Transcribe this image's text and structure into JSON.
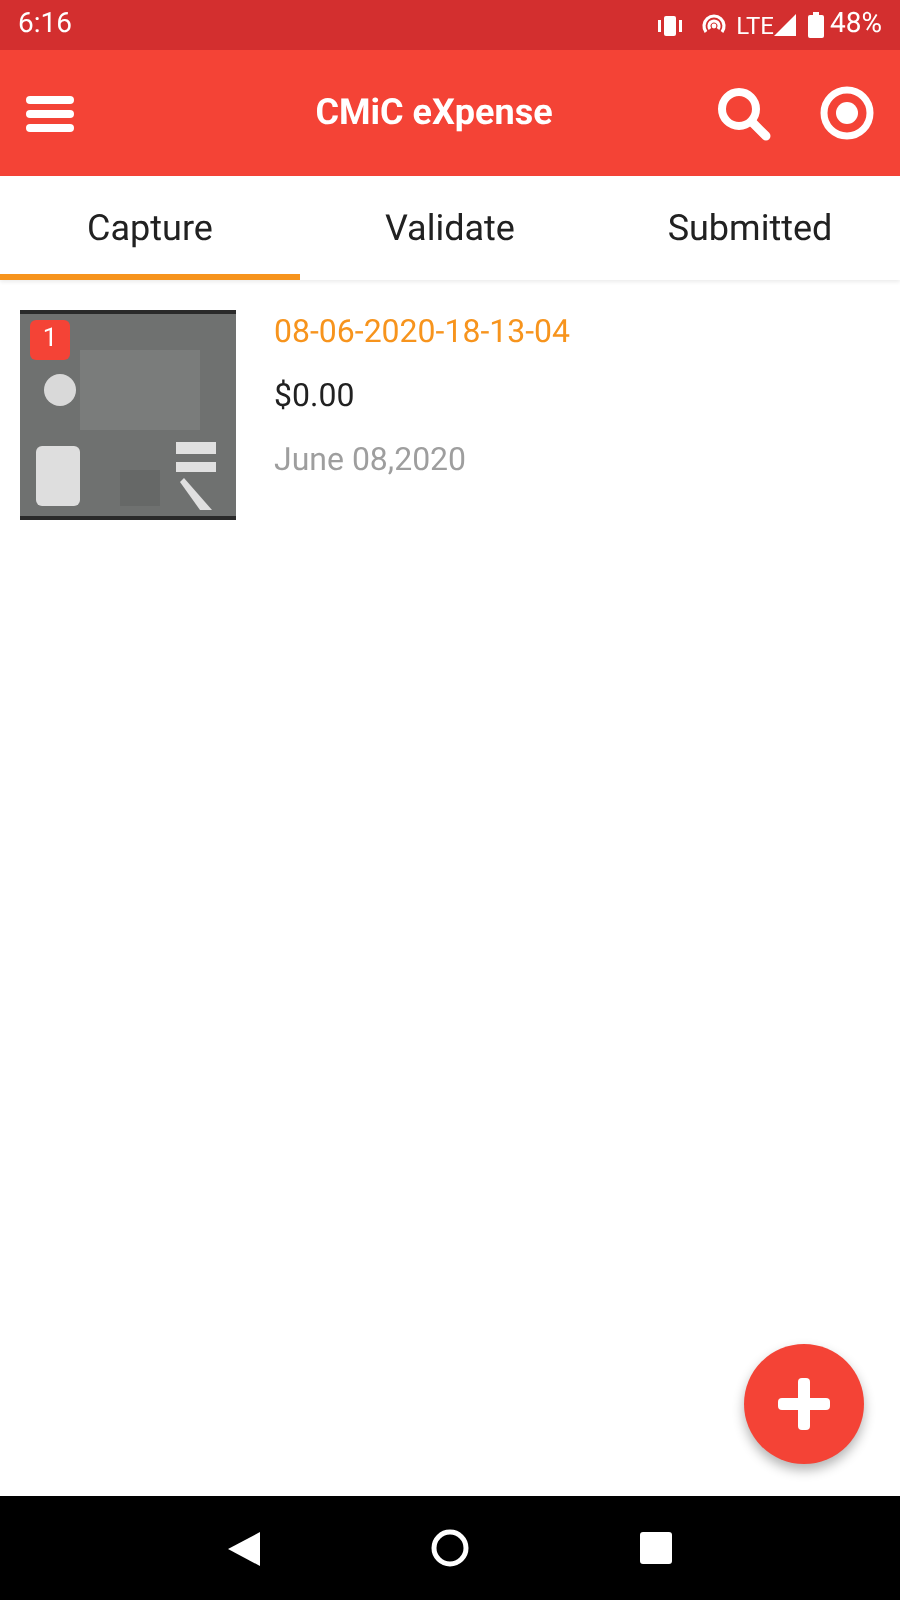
{
  "status_bar": {
    "time": "6:16",
    "network": "LTE",
    "battery": "48%"
  },
  "app_bar": {
    "title": "CMiC eXpense"
  },
  "tabs": [
    {
      "label": "Capture",
      "selected": true
    },
    {
      "label": "Validate",
      "selected": false
    },
    {
      "label": "Submitted",
      "selected": false
    }
  ],
  "expenses": [
    {
      "badge": "1",
      "name": "08-06-2020-18-13-04",
      "amount": "$0.00",
      "date": "June 08,2020"
    }
  ]
}
